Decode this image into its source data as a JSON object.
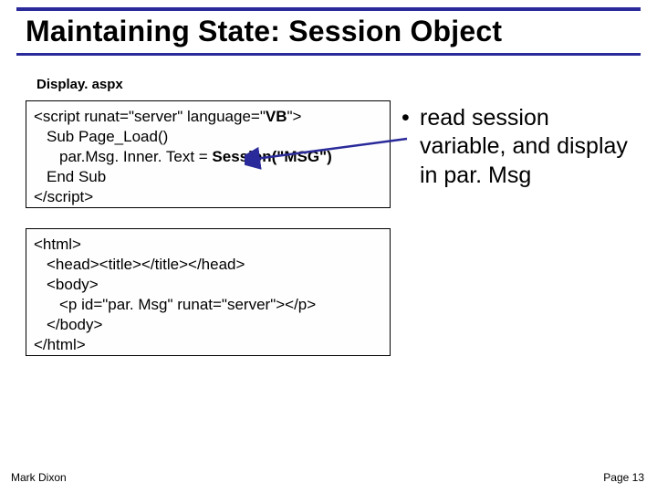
{
  "title": "Maintaining State: Session Object",
  "file_label": "Display. aspx",
  "code1": {
    "l1a": "<script runat=\"server\" language=\"",
    "l1b": "VB",
    "l1c": "\">",
    "l2": "Sub Page_Load()",
    "l3a": "par.Msg. Inner. Text = ",
    "l3b": "Session(\"MSG\")",
    "l4": "End Sub",
    "l5": "</script>"
  },
  "code2": {
    "l1": "<html>",
    "l2": "<head><title></title></head>",
    "l3": "<body>",
    "l4": "<p id=\"par. Msg\" runat=\"server\"></p>",
    "l5": "</body>",
    "l6": "</html>"
  },
  "bullet": {
    "dot": "•",
    "text": "read session variable, and display in par. Msg"
  },
  "footer": {
    "author": "Mark Dixon",
    "page": "Page 13"
  }
}
